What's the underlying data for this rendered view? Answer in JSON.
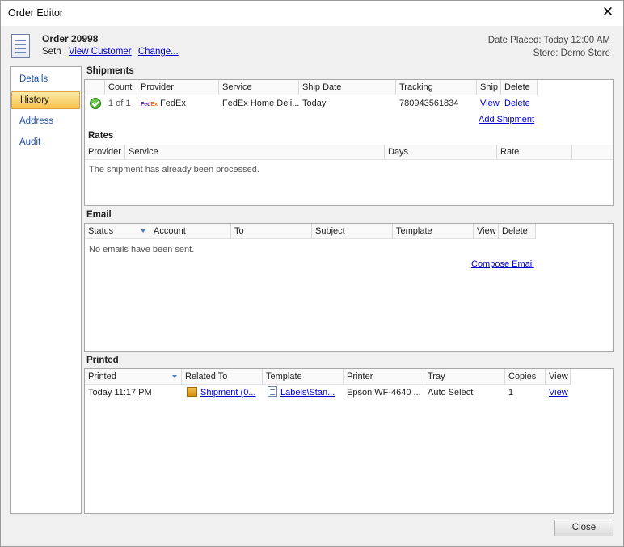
{
  "window": {
    "title": "Order Editor",
    "close_glyph": "✕"
  },
  "order": {
    "title": "Order 20998",
    "customer": "Seth",
    "view_customer": "View Customer",
    "change": "Change...",
    "date_placed": "Date Placed: Today 12:00 AM",
    "store": "Store: Demo Store"
  },
  "nav": {
    "items": [
      "Details",
      "History",
      "Address",
      "Audit"
    ],
    "active": "History"
  },
  "shipments": {
    "label": "Shipments",
    "columns": [
      "",
      "Count",
      "Provider",
      "Service",
      "Ship Date",
      "Tracking",
      "Ship",
      "Delete"
    ],
    "rows": [
      {
        "count": "1 of 1",
        "provider": "FedEx",
        "service": "FedEx Home Deli...",
        "ship_date": "Today",
        "tracking": "780943561834",
        "ship": "View",
        "delete": "Delete"
      }
    ],
    "add_link": "Add Shipment"
  },
  "rates": {
    "label": "Rates",
    "columns": [
      "Provider",
      "Service",
      "Days",
      "Rate"
    ],
    "empty": "The shipment has already been processed."
  },
  "email": {
    "label": "Email",
    "columns": [
      "Status",
      "Account",
      "To",
      "Subject",
      "Template",
      "View",
      "Delete"
    ],
    "empty": "No emails have been sent.",
    "compose_link": "Compose Email"
  },
  "printed": {
    "label": "Printed",
    "columns": [
      "Printed",
      "Related To",
      "Template",
      "Printer",
      "Tray",
      "Copies",
      "View"
    ],
    "rows": [
      {
        "printed": "Today 11:17 PM",
        "related_to": "Shipment (0...",
        "template": "Labels\\Stan...",
        "printer": "Epson WF-4640 ...",
        "tray": "Auto Select",
        "copies": "1",
        "view": "View"
      }
    ]
  },
  "footer": {
    "close_label": "Close"
  },
  "colors": {
    "link": "#0000cc",
    "nav_active": "#f7c24d",
    "success": "#2f9b1c"
  },
  "icons": [
    "order-icon",
    "close-icon",
    "check-icon",
    "fedex-logo",
    "box-icon",
    "template-icon",
    "sort-arrow-icon"
  ]
}
